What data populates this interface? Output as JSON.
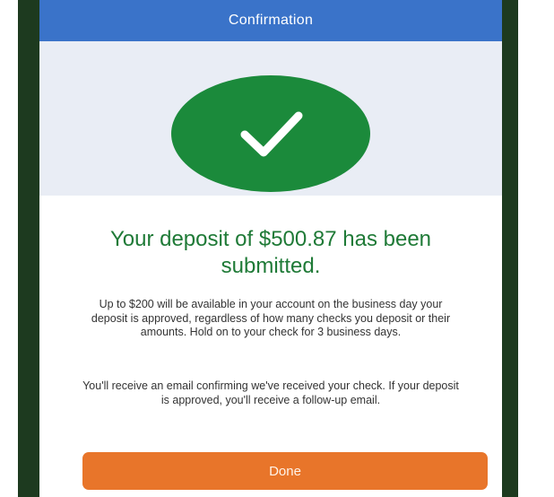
{
  "header": {
    "title": "Confirmation"
  },
  "icons": {
    "success": "checkmark-icon"
  },
  "message": {
    "headline": "Your deposit of $500.87 has been submitted.",
    "availability": "Up to $200 will be available in your account on the business day your deposit is approved, regardless of how many checks you deposit or their amounts. Hold on to your check for 3 business days.",
    "email_notice": "You'll receive an email confirming we've received your check. If your deposit is approved, you'll receive a follow-up email."
  },
  "actions": {
    "done_label": "Done"
  },
  "colors": {
    "header": "#3a73c9",
    "success": "#1b8a3b",
    "headline": "#1f7a37",
    "button": "#e8752a",
    "device_frame": "#1d3a1f"
  }
}
